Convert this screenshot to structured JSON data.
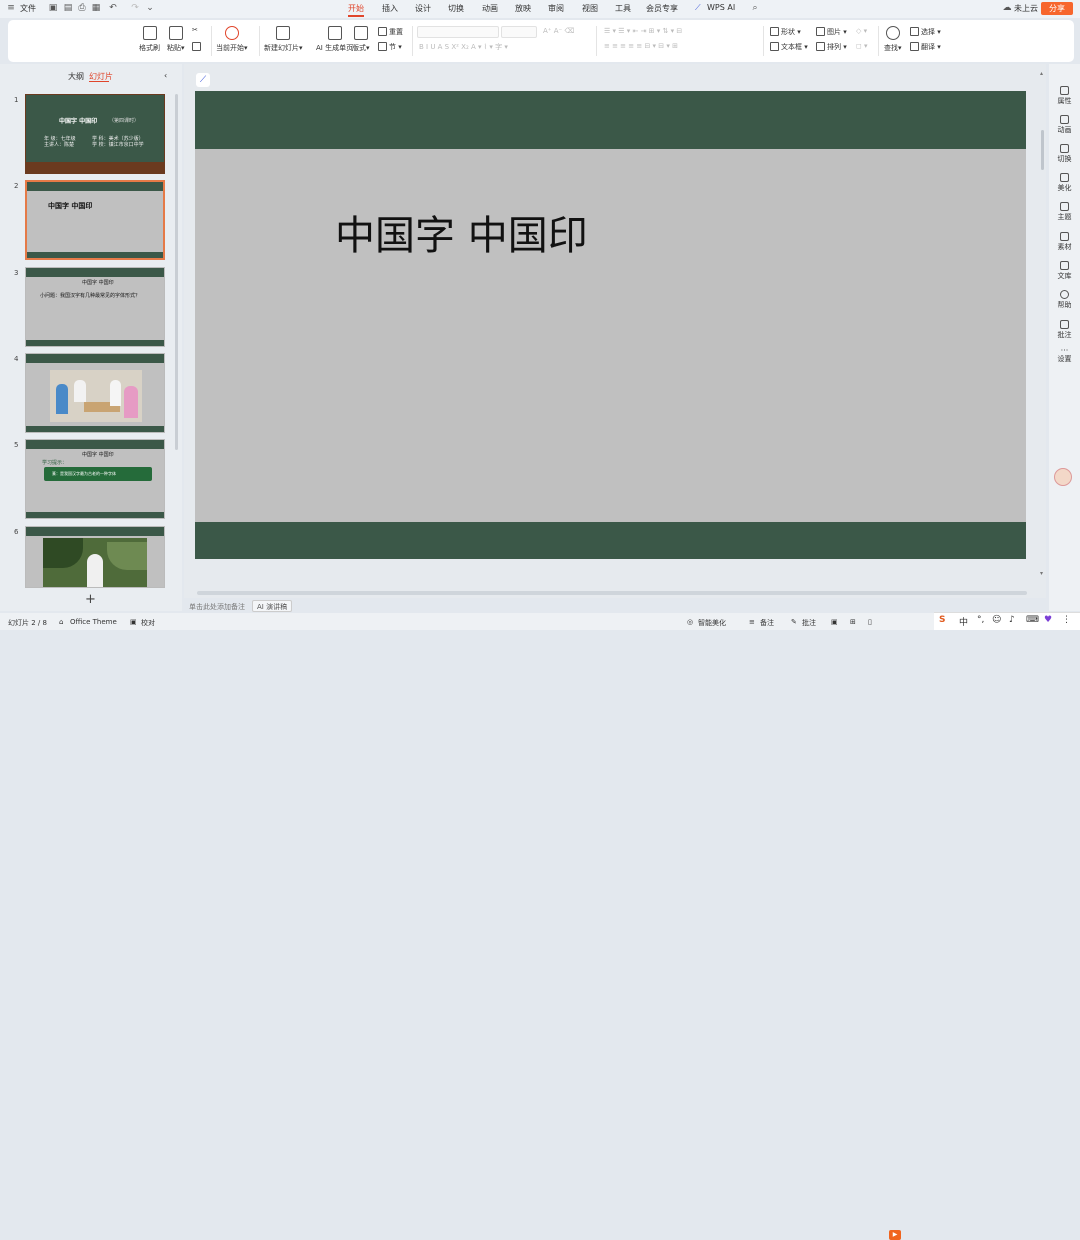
{
  "titlebar": {
    "file_label": "文件",
    "menu": [
      "开始",
      "插入",
      "设计",
      "切换",
      "动画",
      "放映",
      "审阅",
      "视图",
      "工具",
      "会员专享",
      "WPS AI"
    ],
    "cloud_label": "未上云",
    "share_label": "分享"
  },
  "ribbon": {
    "format_painter": "格式刷",
    "paste": "粘贴",
    "play_current": "当前开始",
    "new_slide": "新建幻灯片",
    "ai_single_page": "AI 生成单页",
    "layout": "版式",
    "reset": "重置",
    "section": "节",
    "shape": "形状",
    "picture": "图片",
    "textbox": "文本框",
    "arrange": "排列",
    "find": "查找",
    "select": "选择",
    "translate": "翻译"
  },
  "left_panel": {
    "tabs": [
      "大纲",
      "幻灯片"
    ],
    "slides": [
      {
        "num": "1",
        "title": "中国字  中国印",
        "subtitle": "（第四课时）",
        "info": [
          "年  级：七年级",
          "学  科：美术（苏少版）",
          "主讲人：陈楚",
          "学  校：镇江市京口中学"
        ]
      },
      {
        "num": "2",
        "title": "中国字  中国印"
      },
      {
        "num": "3",
        "title": "中国字  中国印",
        "question": "小问题：我国汉字有几种最常见的字体形式？"
      },
      {
        "num": "4"
      },
      {
        "num": "5",
        "title": "中国字  中国印",
        "note": "学习提示：",
        "bar_text": "篆：是我国汉字最为古老的一种字体"
      },
      {
        "num": "6"
      }
    ]
  },
  "slide": {
    "title": "中国字  中国印",
    "top_color": "#3b5848",
    "bg_color": "#c0c0c0"
  },
  "notes": {
    "placeholder": "单击此处添加备注",
    "ai_speech": "AI 演讲稿"
  },
  "right_panel": [
    "属性",
    "动画",
    "切换",
    "美化",
    "主题",
    "素材",
    "文库",
    "帮助",
    "批注",
    "设置"
  ],
  "statusbar": {
    "slide_count": "幻灯片 2 / 8",
    "theme": "Office Theme",
    "proofread": "校对",
    "smart_beautify": "智能美化",
    "notes": "备注",
    "comment": "批注"
  },
  "ime": {
    "label": "中"
  }
}
